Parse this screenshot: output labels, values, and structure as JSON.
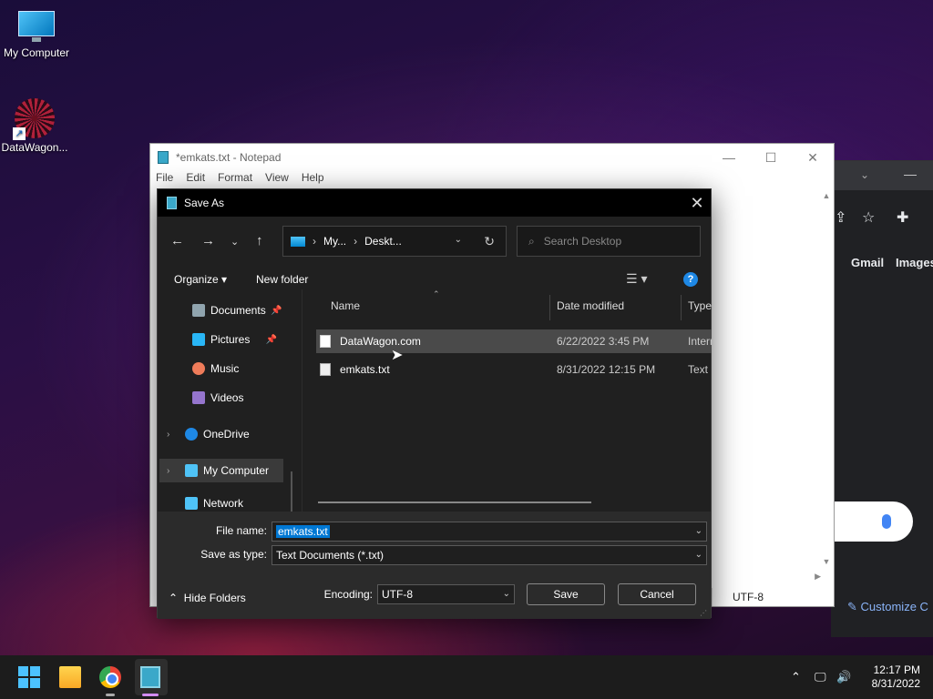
{
  "desktop": {
    "icons": [
      {
        "label": "My Computer"
      },
      {
        "label": "DataWagon..."
      }
    ]
  },
  "browser": {
    "links": [
      "Gmail",
      "Images"
    ],
    "customize_label": "Customize C"
  },
  "notepad": {
    "title": "*emkats.txt - Notepad",
    "menu": [
      "File",
      "Edit",
      "Format",
      "View",
      "Help"
    ],
    "status_encoding": "UTF-8"
  },
  "dialog": {
    "title": "Save As",
    "address": {
      "segments": [
        "My...",
        "Deskt..."
      ]
    },
    "search_placeholder": "Search Desktop",
    "organize_label": "Organize",
    "new_folder_label": "New folder",
    "nav_items": [
      {
        "label": "Documents",
        "color": "#90a4ae"
      },
      {
        "label": "Pictures",
        "color": "#29b6f6"
      },
      {
        "label": "Music",
        "color": "#ef7c5a"
      },
      {
        "label": "Videos",
        "color": "#9575cd"
      },
      {
        "label": "OneDrive",
        "color": "#1e88e5"
      },
      {
        "label": "My Computer",
        "color": "#4fc3f7"
      },
      {
        "label": "Network",
        "color": "#4fc3f7"
      }
    ],
    "columns": [
      "Name",
      "Date modified",
      "Type"
    ],
    "files": [
      {
        "name": "DataWagon.com",
        "date": "6/22/2022 3:45 PM",
        "type": "Internet Shortcut"
      },
      {
        "name": "emkats.txt",
        "date": "8/31/2022 12:15 PM",
        "type": "Text Document"
      }
    ],
    "file_name_label": "File name:",
    "file_name_value": "emkats.txt",
    "save_type_label": "Save as type:",
    "save_type_value": "Text Documents (*.txt)",
    "hide_folders_label": "Hide Folders",
    "encoding_label": "Encoding:",
    "encoding_value": "UTF-8",
    "save_label": "Save",
    "cancel_label": "Cancel"
  },
  "taskbar": {
    "time": "12:17 PM",
    "date": "8/31/2022"
  }
}
